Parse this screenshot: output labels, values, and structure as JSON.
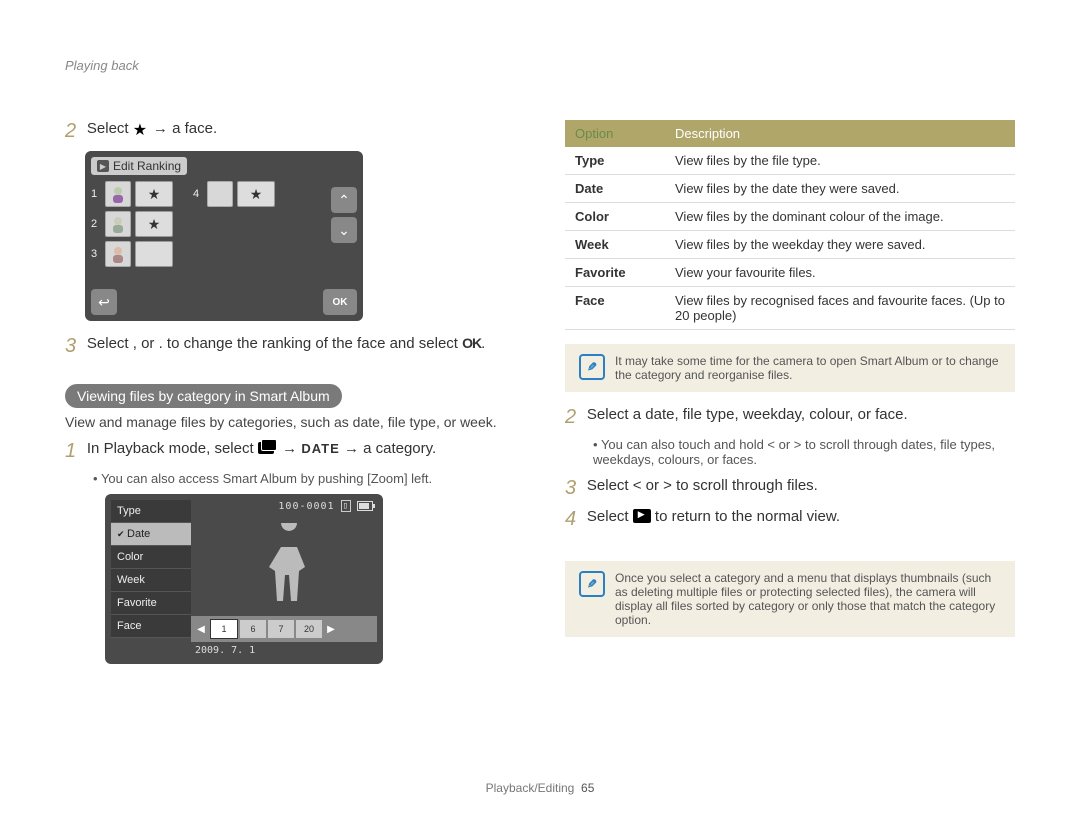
{
  "header_breadcrumb": "Playing back",
  "left": {
    "step2_num": "2",
    "step2_text_a": "Select ",
    "step2_text_b": " → a face.",
    "rank_title": "Edit Ranking",
    "rank_items_a": [
      "1",
      "2",
      "3"
    ],
    "rank_items_b": [
      "4"
    ],
    "step3_num": "3",
    "step3_text": "Select ,    or .    to change the ranking of the face and select ",
    "step3_ok": "OK",
    "step3_period": ".",
    "pill": "Viewing files by category in Smart Album",
    "pill_para": "View and manage files by categories, such as date, file type, or week.",
    "step1_num": "1",
    "step1_text_a": "In Playback mode, select ",
    "step1_date_word": "DATE",
    "step1_text_b": " → a category.",
    "step1_bullet": "You can also access Smart Album by pushing [Zoom] left.",
    "catbox": {
      "menu": [
        "Type",
        "Date",
        "Color",
        "Week",
        "Favorite",
        "Face"
      ],
      "selected": "Date",
      "counter": "100-0001",
      "thumbs": [
        "1",
        "6",
        "7",
        "20"
      ],
      "date": "2009. 7. 1"
    }
  },
  "right": {
    "table": {
      "h1": "Option",
      "h2": "Description",
      "rows": [
        {
          "o": "Type",
          "d": "View files by the file type."
        },
        {
          "o": "Date",
          "d": "View files by the date they were saved."
        },
        {
          "o": "Color",
          "d": "View files by the dominant colour of the image."
        },
        {
          "o": "Week",
          "d": "View files by the weekday they were saved."
        },
        {
          "o": "Favorite",
          "d": "View your favourite files."
        },
        {
          "o": "Face",
          "d": "View files by recognised faces and favourite faces. (Up to 20 people)"
        }
      ]
    },
    "note1": "It may take some time for the camera to open Smart Album or to change the category and reorganise files.",
    "step2_num": "2",
    "step2_text": "Select a date, file type, weekday, colour, or face.",
    "step2_bullet": "You can also touch and hold  <  or  >  to scroll through dates, file types, weekdays, colours, or faces.",
    "step3_num": "3",
    "step3_text": "Select  <  or  >  to scroll through files.",
    "step4_num": "4",
    "step4_text_a": "Select ",
    "step4_text_b": " to return to the normal view.",
    "note2": "Once you select a category and a menu that displays thumbnails (such as deleting multiple files or protecting selected files), the camera will display all files sorted by category or only those that match the category option."
  },
  "footer": {
    "section": "Playback/Editing",
    "page": "65"
  }
}
